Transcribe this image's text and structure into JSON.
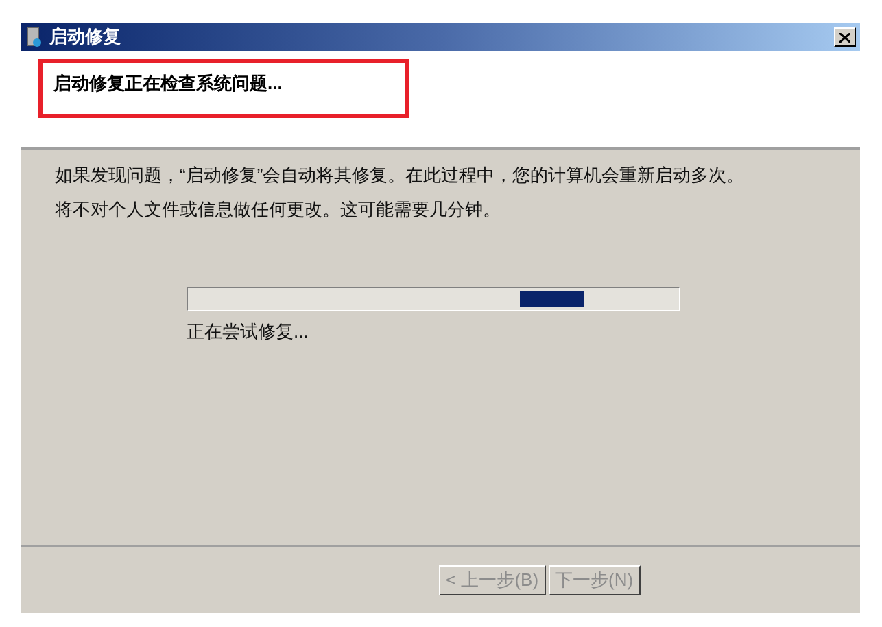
{
  "window": {
    "title": "启动修复"
  },
  "header": {
    "text": "启动修复正在检查系统问题...",
    "highlighted": true
  },
  "paragraphs": [
    "如果发现问题，“启动修复”会自动将其修复。在此过程中，您的计算机会重新启动多次。",
    "将不对个人文件或信息做任何更改。这可能需要几分钟。"
  ],
  "progress": {
    "indeterminate": true,
    "caption": "正在尝试修复..."
  },
  "buttons": [
    {
      "label": "< 上一步(B)",
      "disabled": true
    },
    {
      "label": "下一步(N)",
      "disabled": true
    }
  ]
}
